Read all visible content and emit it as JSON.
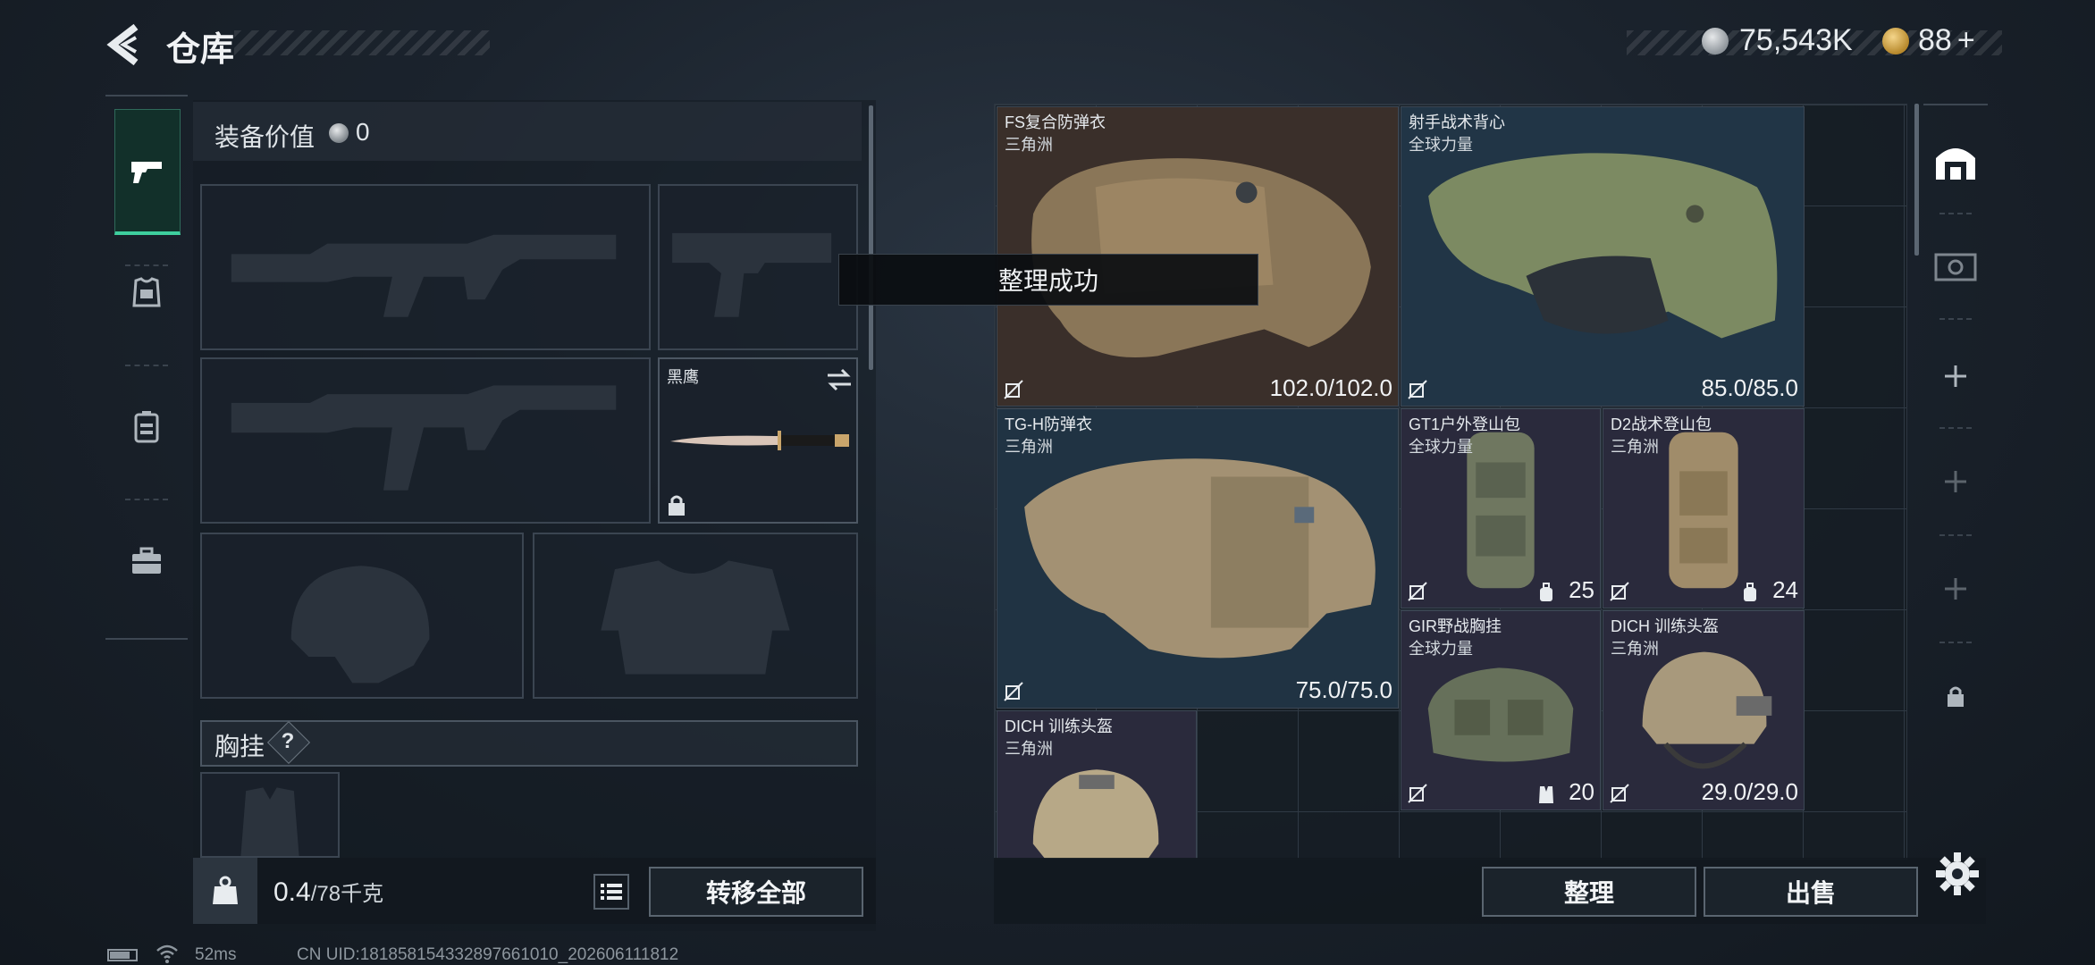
{
  "header": {
    "title": "仓库",
    "currency_silver": "75,543K",
    "currency_gold": "88",
    "currency_gold_plus": "+"
  },
  "sidebar_left": {
    "categories": [
      {
        "id": "weapons",
        "icon": "pistol-icon",
        "active": true
      },
      {
        "id": "armor",
        "icon": "armor-vest-icon",
        "active": false
      },
      {
        "id": "backpack",
        "icon": "backpack-icon",
        "active": false
      },
      {
        "id": "supplies",
        "icon": "toolbox-icon",
        "active": false
      }
    ]
  },
  "equipment": {
    "value_label": "装备价值",
    "value": "0",
    "melee_name": "黑鹰",
    "chest_rig_label": "胸挂",
    "help_mark": "?",
    "weight": "0.4",
    "weight_capacity": "/78千克",
    "transfer_all_label": "转移全部"
  },
  "toast": "整理成功",
  "storage": {
    "items": [
      {
        "name": "FS复合防弹衣",
        "source": "三角洲",
        "value": "102.0/102.0"
      },
      {
        "name": "射手战术背心",
        "source": "全球力量",
        "value": "85.0/85.0"
      },
      {
        "name": "TG-H防弹衣",
        "source": "三角洲",
        "value": "75.0/75.0"
      },
      {
        "name": "GT1户外登山包",
        "source": "全球力量",
        "value": "25"
      },
      {
        "name": "D2战术登山包",
        "source": "三角洲",
        "value": "24"
      },
      {
        "name": "GIR野战胸挂",
        "source": "全球力量",
        "value": "20"
      },
      {
        "name": "DICH 训练头盔",
        "source": "三角洲",
        "value": "29.0/29.0"
      },
      {
        "name": "DICH 训练头盔",
        "source": "三角洲",
        "value": ""
      }
    ],
    "sort_label": "整理",
    "sell_label": "出售"
  },
  "status": {
    "ping": "52ms",
    "uid": "CN UID:181858154332897661010_202606111812"
  },
  "colors": {
    "accent_green": "#3ecf9e",
    "panel_bg": "#1b232b",
    "item_brown": "#3a2e28",
    "item_blue": "#203343",
    "item_purple": "#2a2a3c"
  }
}
